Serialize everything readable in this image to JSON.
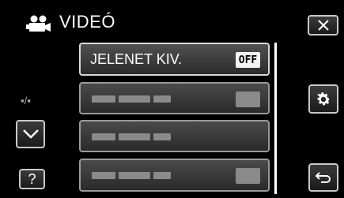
{
  "header": {
    "title": "VIDEÓ",
    "mode_icon": "video-camera-icon"
  },
  "menu": {
    "items": [
      {
        "label": "JELENET KIV.",
        "value": "OFF",
        "active": true
      },
      {
        "label": "",
        "value": "",
        "active": false,
        "blurred": true
      },
      {
        "label": "",
        "value": "",
        "active": false,
        "blurred": true
      },
      {
        "label": "",
        "value": "",
        "active": false,
        "blurred": true
      }
    ]
  },
  "sidebar": {
    "page_indicator": "▪/▪",
    "down_icon": "chevron-down-icon",
    "help_label": "?"
  },
  "right_buttons": {
    "close_icon": "close-icon",
    "settings_icon": "gear-icon",
    "back_icon": "return-icon"
  }
}
